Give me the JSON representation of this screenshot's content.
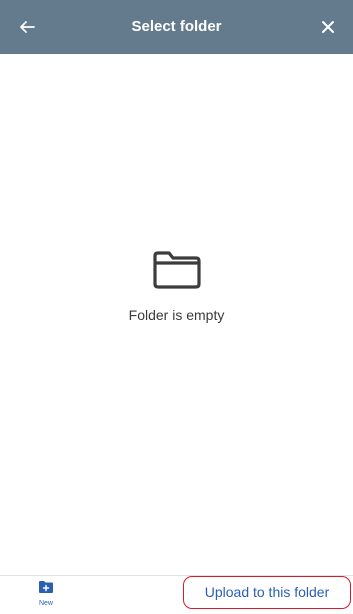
{
  "header": {
    "title": "Select folder",
    "back_icon": "arrow-left-icon",
    "close_icon": "close-icon",
    "background": "#637b8c"
  },
  "empty_state": {
    "icon": "folder-icon",
    "message": "Folder is empty"
  },
  "bottom_bar": {
    "new_folder": {
      "icon": "folder-plus-icon",
      "label": "New"
    },
    "upload_button_label": "Upload to this folder",
    "accent_color": "#2a5fb4",
    "highlight_color": "#d51e2a"
  }
}
